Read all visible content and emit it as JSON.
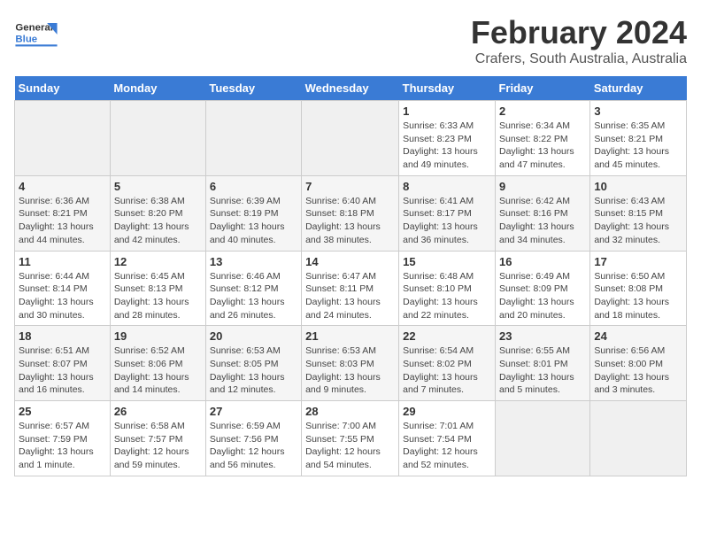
{
  "header": {
    "logo_general": "General",
    "logo_blue": "Blue",
    "title": "February 2024",
    "subtitle": "Crafers, South Australia, Australia"
  },
  "days_of_week": [
    "Sunday",
    "Monday",
    "Tuesday",
    "Wednesday",
    "Thursday",
    "Friday",
    "Saturday"
  ],
  "weeks": [
    [
      {
        "day": "",
        "details": []
      },
      {
        "day": "",
        "details": []
      },
      {
        "day": "",
        "details": []
      },
      {
        "day": "",
        "details": []
      },
      {
        "day": "1",
        "details": [
          "Sunrise: 6:33 AM",
          "Sunset: 8:23 PM",
          "Daylight: 13 hours",
          "and 49 minutes."
        ]
      },
      {
        "day": "2",
        "details": [
          "Sunrise: 6:34 AM",
          "Sunset: 8:22 PM",
          "Daylight: 13 hours",
          "and 47 minutes."
        ]
      },
      {
        "day": "3",
        "details": [
          "Sunrise: 6:35 AM",
          "Sunset: 8:21 PM",
          "Daylight: 13 hours",
          "and 45 minutes."
        ]
      }
    ],
    [
      {
        "day": "4",
        "details": [
          "Sunrise: 6:36 AM",
          "Sunset: 8:21 PM",
          "Daylight: 13 hours",
          "and 44 minutes."
        ]
      },
      {
        "day": "5",
        "details": [
          "Sunrise: 6:38 AM",
          "Sunset: 8:20 PM",
          "Daylight: 13 hours",
          "and 42 minutes."
        ]
      },
      {
        "day": "6",
        "details": [
          "Sunrise: 6:39 AM",
          "Sunset: 8:19 PM",
          "Daylight: 13 hours",
          "and 40 minutes."
        ]
      },
      {
        "day": "7",
        "details": [
          "Sunrise: 6:40 AM",
          "Sunset: 8:18 PM",
          "Daylight: 13 hours",
          "and 38 minutes."
        ]
      },
      {
        "day": "8",
        "details": [
          "Sunrise: 6:41 AM",
          "Sunset: 8:17 PM",
          "Daylight: 13 hours",
          "and 36 minutes."
        ]
      },
      {
        "day": "9",
        "details": [
          "Sunrise: 6:42 AM",
          "Sunset: 8:16 PM",
          "Daylight: 13 hours",
          "and 34 minutes."
        ]
      },
      {
        "day": "10",
        "details": [
          "Sunrise: 6:43 AM",
          "Sunset: 8:15 PM",
          "Daylight: 13 hours",
          "and 32 minutes."
        ]
      }
    ],
    [
      {
        "day": "11",
        "details": [
          "Sunrise: 6:44 AM",
          "Sunset: 8:14 PM",
          "Daylight: 13 hours",
          "and 30 minutes."
        ]
      },
      {
        "day": "12",
        "details": [
          "Sunrise: 6:45 AM",
          "Sunset: 8:13 PM",
          "Daylight: 13 hours",
          "and 28 minutes."
        ]
      },
      {
        "day": "13",
        "details": [
          "Sunrise: 6:46 AM",
          "Sunset: 8:12 PM",
          "Daylight: 13 hours",
          "and 26 minutes."
        ]
      },
      {
        "day": "14",
        "details": [
          "Sunrise: 6:47 AM",
          "Sunset: 8:11 PM",
          "Daylight: 13 hours",
          "and 24 minutes."
        ]
      },
      {
        "day": "15",
        "details": [
          "Sunrise: 6:48 AM",
          "Sunset: 8:10 PM",
          "Daylight: 13 hours",
          "and 22 minutes."
        ]
      },
      {
        "day": "16",
        "details": [
          "Sunrise: 6:49 AM",
          "Sunset: 8:09 PM",
          "Daylight: 13 hours",
          "and 20 minutes."
        ]
      },
      {
        "day": "17",
        "details": [
          "Sunrise: 6:50 AM",
          "Sunset: 8:08 PM",
          "Daylight: 13 hours",
          "and 18 minutes."
        ]
      }
    ],
    [
      {
        "day": "18",
        "details": [
          "Sunrise: 6:51 AM",
          "Sunset: 8:07 PM",
          "Daylight: 13 hours",
          "and 16 minutes."
        ]
      },
      {
        "day": "19",
        "details": [
          "Sunrise: 6:52 AM",
          "Sunset: 8:06 PM",
          "Daylight: 13 hours",
          "and 14 minutes."
        ]
      },
      {
        "day": "20",
        "details": [
          "Sunrise: 6:53 AM",
          "Sunset: 8:05 PM",
          "Daylight: 13 hours",
          "and 12 minutes."
        ]
      },
      {
        "day": "21",
        "details": [
          "Sunrise: 6:53 AM",
          "Sunset: 8:03 PM",
          "Daylight: 13 hours",
          "and 9 minutes."
        ]
      },
      {
        "day": "22",
        "details": [
          "Sunrise: 6:54 AM",
          "Sunset: 8:02 PM",
          "Daylight: 13 hours",
          "and 7 minutes."
        ]
      },
      {
        "day": "23",
        "details": [
          "Sunrise: 6:55 AM",
          "Sunset: 8:01 PM",
          "Daylight: 13 hours",
          "and 5 minutes."
        ]
      },
      {
        "day": "24",
        "details": [
          "Sunrise: 6:56 AM",
          "Sunset: 8:00 PM",
          "Daylight: 13 hours",
          "and 3 minutes."
        ]
      }
    ],
    [
      {
        "day": "25",
        "details": [
          "Sunrise: 6:57 AM",
          "Sunset: 7:59 PM",
          "Daylight: 13 hours",
          "and 1 minute."
        ]
      },
      {
        "day": "26",
        "details": [
          "Sunrise: 6:58 AM",
          "Sunset: 7:57 PM",
          "Daylight: 12 hours",
          "and 59 minutes."
        ]
      },
      {
        "day": "27",
        "details": [
          "Sunrise: 6:59 AM",
          "Sunset: 7:56 PM",
          "Daylight: 12 hours",
          "and 56 minutes."
        ]
      },
      {
        "day": "28",
        "details": [
          "Sunrise: 7:00 AM",
          "Sunset: 7:55 PM",
          "Daylight: 12 hours",
          "and 54 minutes."
        ]
      },
      {
        "day": "29",
        "details": [
          "Sunrise: 7:01 AM",
          "Sunset: 7:54 PM",
          "Daylight: 12 hours",
          "and 52 minutes."
        ]
      },
      {
        "day": "",
        "details": []
      },
      {
        "day": "",
        "details": []
      }
    ]
  ]
}
